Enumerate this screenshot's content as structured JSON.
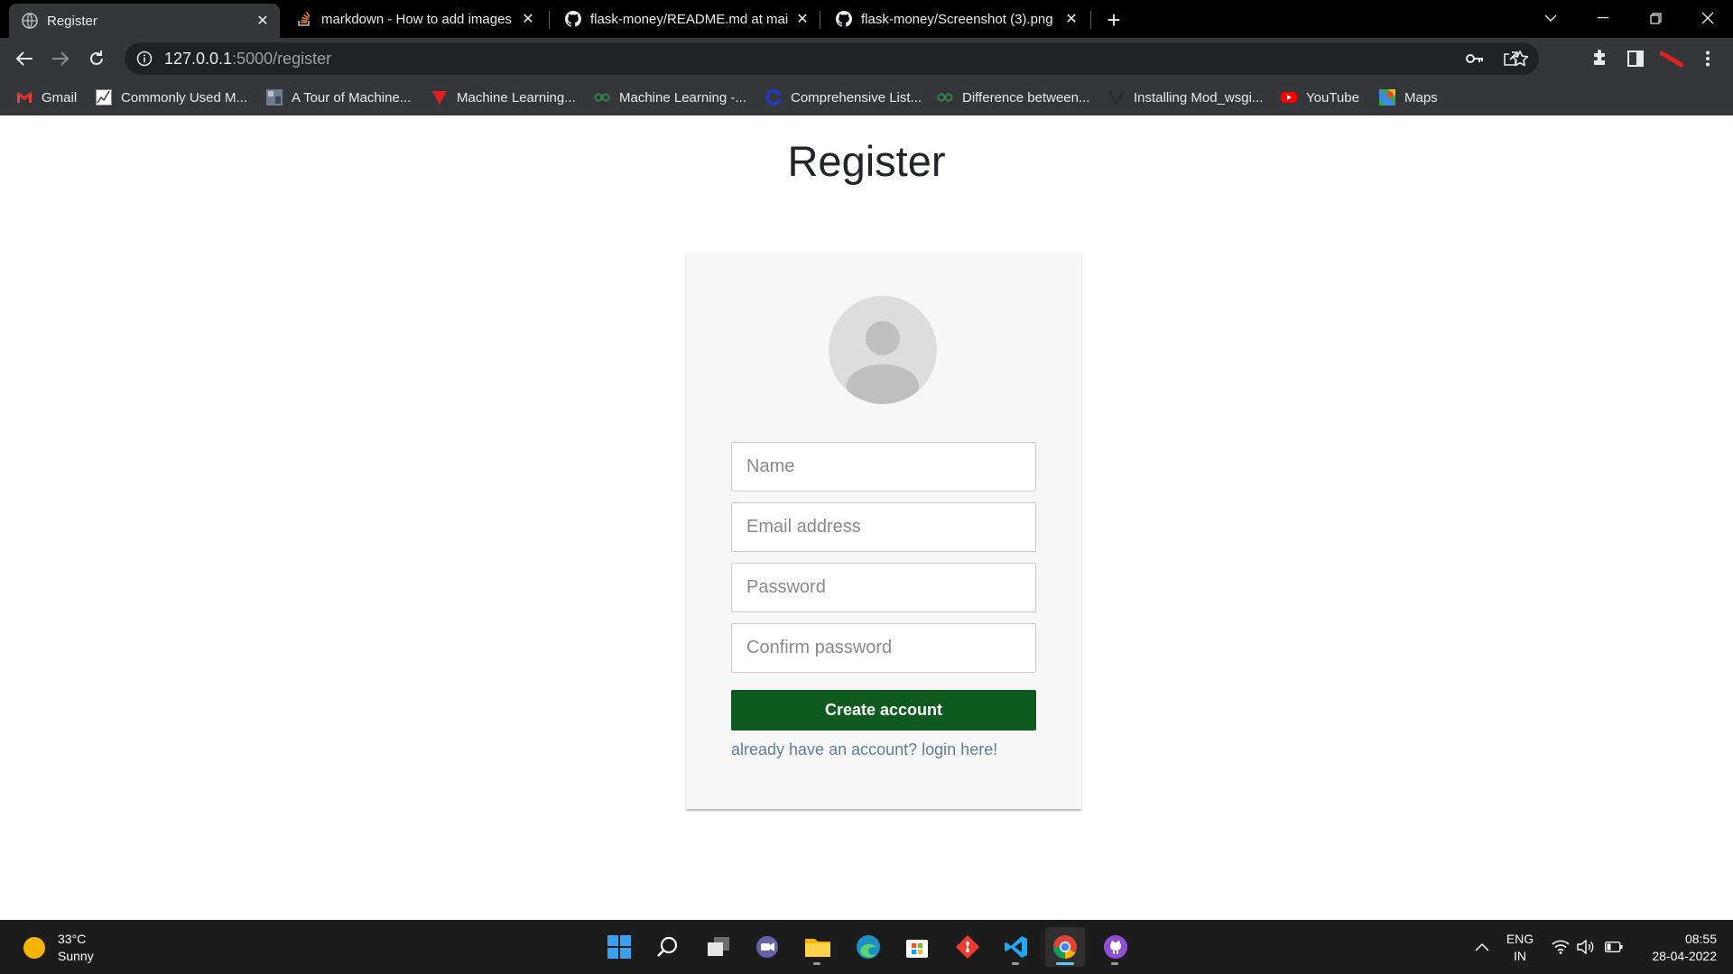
{
  "browser": {
    "tabs": [
      {
        "title": "Register",
        "icon": "globe-icon",
        "active": true
      },
      {
        "title": "markdown - How to add images",
        "icon": "stackoverflow-icon",
        "active": false
      },
      {
        "title": "flask-money/README.md at mai",
        "icon": "github-icon",
        "active": false
      },
      {
        "title": "flask-money/Screenshot (3).png",
        "icon": "github-icon",
        "active": false
      }
    ],
    "url_host": "127.0.0.1",
    "url_path": ":5000/register",
    "bookmarks": [
      {
        "label": "Gmail",
        "icon": "gmail-icon"
      },
      {
        "label": "Commonly Used M...",
        "icon": "chart-icon"
      },
      {
        "label": "A Tour of Machine...",
        "icon": "image-icon"
      },
      {
        "label": "Machine Learning...",
        "icon": "red-v-icon"
      },
      {
        "label": "Machine Learning -...",
        "icon": "gfg-icon"
      },
      {
        "label": "Comprehensive List...",
        "icon": "blue-c-icon"
      },
      {
        "label": "Difference between...",
        "icon": "gfg-icon"
      },
      {
        "label": "Installing Mod_wsgi...",
        "icon": "v-icon"
      },
      {
        "label": "YouTube",
        "icon": "youtube-icon"
      },
      {
        "label": "Maps",
        "icon": "maps-icon"
      }
    ]
  },
  "page": {
    "title": "Register",
    "form": {
      "name_placeholder": "Name",
      "email_placeholder": "Email address",
      "password_placeholder": "Password",
      "confirm_placeholder": "Confirm password",
      "submit_label": "Create account",
      "login_link": "already have an account? login here!"
    },
    "colors": {
      "submit_bg": "#0f5a1f",
      "link": "#5f7f97",
      "card_bg": "#f7f7f7"
    }
  },
  "taskbar": {
    "weather_temp": "33°C",
    "weather_desc": "Sunny",
    "apps": [
      "start-icon",
      "search-icon",
      "task-view-icon",
      "teams-chat-icon",
      "file-explorer-icon",
      "edge-icon",
      "store-icon",
      "git-icon",
      "vscode-icon",
      "chrome-icon",
      "github-desktop-icon"
    ],
    "lang_top": "ENG",
    "lang_bottom": "IN",
    "time": "08:55",
    "date": "28-04-2022"
  }
}
